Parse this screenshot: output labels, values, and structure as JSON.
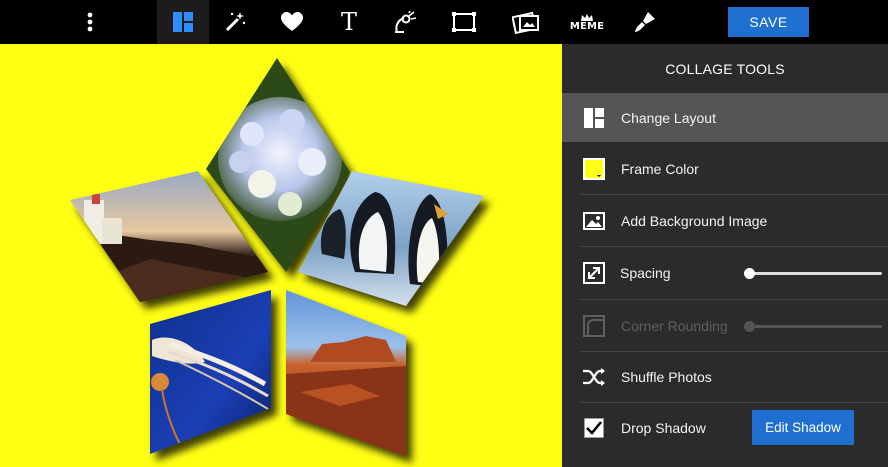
{
  "toolbar": {
    "items": [
      {
        "icon": "more-vertical-icon"
      },
      {
        "icon": "layout-grid-icon",
        "active": true
      },
      {
        "icon": "magic-wand-icon"
      },
      {
        "icon": "heart-icon"
      },
      {
        "icon": "text-icon",
        "glyph": "T"
      },
      {
        "icon": "sticker-icon"
      },
      {
        "icon": "frame-icon"
      },
      {
        "icon": "photo-icon"
      },
      {
        "icon": "meme-icon",
        "text": "MEME"
      },
      {
        "icon": "brush-icon"
      }
    ],
    "save_label": "SAVE",
    "accent": "#1f6fd1"
  },
  "canvas": {
    "background": "#ffff14",
    "photos": [
      "lighthouse",
      "hydrangea",
      "penguins",
      "jellyfish",
      "desert-butte"
    ]
  },
  "panel": {
    "title": "COLLAGE TOOLS",
    "items": [
      {
        "label": "Change Layout",
        "icon": "layout-icon",
        "selected": true
      },
      {
        "label": "Frame Color",
        "icon": "color-swatch-icon",
        "swatch": "#ffff14"
      },
      {
        "label": "Add Background Image",
        "icon": "image-icon"
      },
      {
        "label": "Spacing",
        "icon": "resize-icon",
        "slider": 0
      },
      {
        "label": "Corner Rounding",
        "icon": "corner-icon",
        "slider": 0,
        "disabled": true
      },
      {
        "label": "Shuffle Photos",
        "icon": "shuffle-icon"
      },
      {
        "label": "Drop Shadow",
        "icon": "checkbox-icon",
        "checked": true,
        "action": "Edit Shadow"
      }
    ]
  }
}
